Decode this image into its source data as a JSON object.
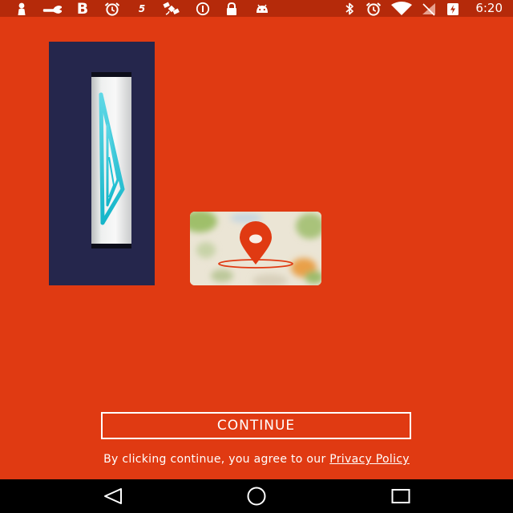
{
  "status_bar": {
    "time": "6:20",
    "left_icons": [
      "person-icon",
      "wrench-icon",
      "b-icon",
      "alarm-icon",
      "five-icon",
      "satellite-icon",
      "info-icon",
      "lock-icon",
      "android-icon"
    ],
    "five_glyph": "5",
    "b_glyph": "B",
    "right_icons": [
      "bluetooth-icon",
      "alarm-icon",
      "wifi-icon",
      "no-signal-icon",
      "battery-charging-icon"
    ]
  },
  "main": {
    "continue_label": "CONTINUE",
    "consent_text": "By clicking continue, you agree to our ",
    "privacy_link": "Privacy Policy"
  },
  "colors": {
    "background": "#e03a12",
    "status_bar": "#b52a0a",
    "tile_navy": "#25264c",
    "accent_cyan": "#1fc3d6",
    "pin_red": "#e03a12",
    "nav_bar": "#000000"
  },
  "nav": {
    "buttons": [
      "back-icon",
      "home-icon",
      "recents-icon"
    ]
  }
}
